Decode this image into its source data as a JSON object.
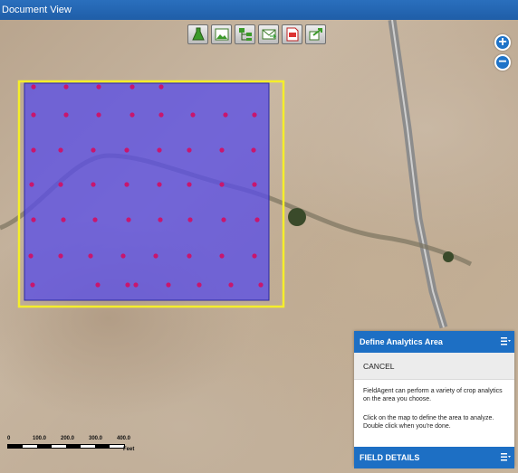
{
  "window": {
    "title": "Document View"
  },
  "toolbar": {
    "buttons": [
      {
        "icon": "flask-icon"
      },
      {
        "icon": "image-icon"
      },
      {
        "icon": "hierarchy-icon"
      },
      {
        "icon": "email-icon"
      },
      {
        "icon": "pdf-icon"
      },
      {
        "icon": "export-icon"
      }
    ]
  },
  "zoom": {
    "in_label": "+",
    "out_label": "−"
  },
  "scalebar": {
    "ticks": [
      "0",
      "100.0",
      "200.0",
      "300.0",
      "400.0"
    ],
    "unit": "Feet"
  },
  "analytics_panel": {
    "title": "Define Analytics Area",
    "cancel_label": "CANCEL",
    "description": "FieldAgent can perform a variety of crop analytics on the area you choose.",
    "instructions": "Click on the map to define the area to analyze. Double click when you're done."
  },
  "field_details_panel": {
    "title": "FIELD DETAILS"
  },
  "colors": {
    "accent": "#1d6fc4",
    "selection_border": "#f5ee2a",
    "analysis_fill": "#5a4ee6",
    "sample_point": "#c8166e"
  }
}
